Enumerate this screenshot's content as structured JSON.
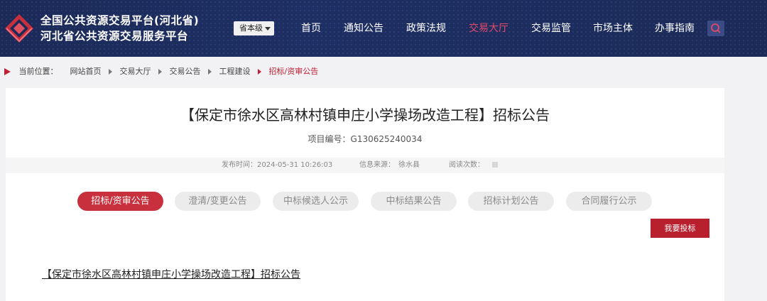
{
  "header": {
    "site_title_line1": "全国公共资源交易平台(河北省)",
    "site_title_line2": "河北省公共资源交易服务平台",
    "level_select": "省本级",
    "nav": [
      "首页",
      "通知公告",
      "政策法规",
      "交易大厅",
      "交易监管",
      "市场主体",
      "办事指南"
    ],
    "active_nav": "交易大厅",
    "colors": {
      "header_bg": "#1b2a57",
      "active_nav": "#e24a6a",
      "accent_red": "#c02035"
    }
  },
  "breadcrumb": {
    "label": "当前位置：",
    "items": [
      "网站首页",
      "交易大厅",
      "交易公告",
      "工程建设",
      "招标/资审公告"
    ]
  },
  "article": {
    "title": "【保定市徐水区高林村镇申庄小学操场改造工程】招标公告",
    "project_no": "项目编号：G130625240034",
    "publish_time": "发布时间：2024-05-31 10:26:03",
    "source": "信息来源：　徐水县",
    "reads": "阅读次数：",
    "tabs": [
      "招标/资审公告",
      "澄清/变更公告",
      "中标候选人公示",
      "中标结果公告",
      "招标计划公告",
      "合同履行公示"
    ],
    "active_tab": "招标/资审公告",
    "bid_button": "我要投标",
    "doc_heading": "【保定市徐水区高林村镇申庄小学操场改造工程】招标公告"
  }
}
